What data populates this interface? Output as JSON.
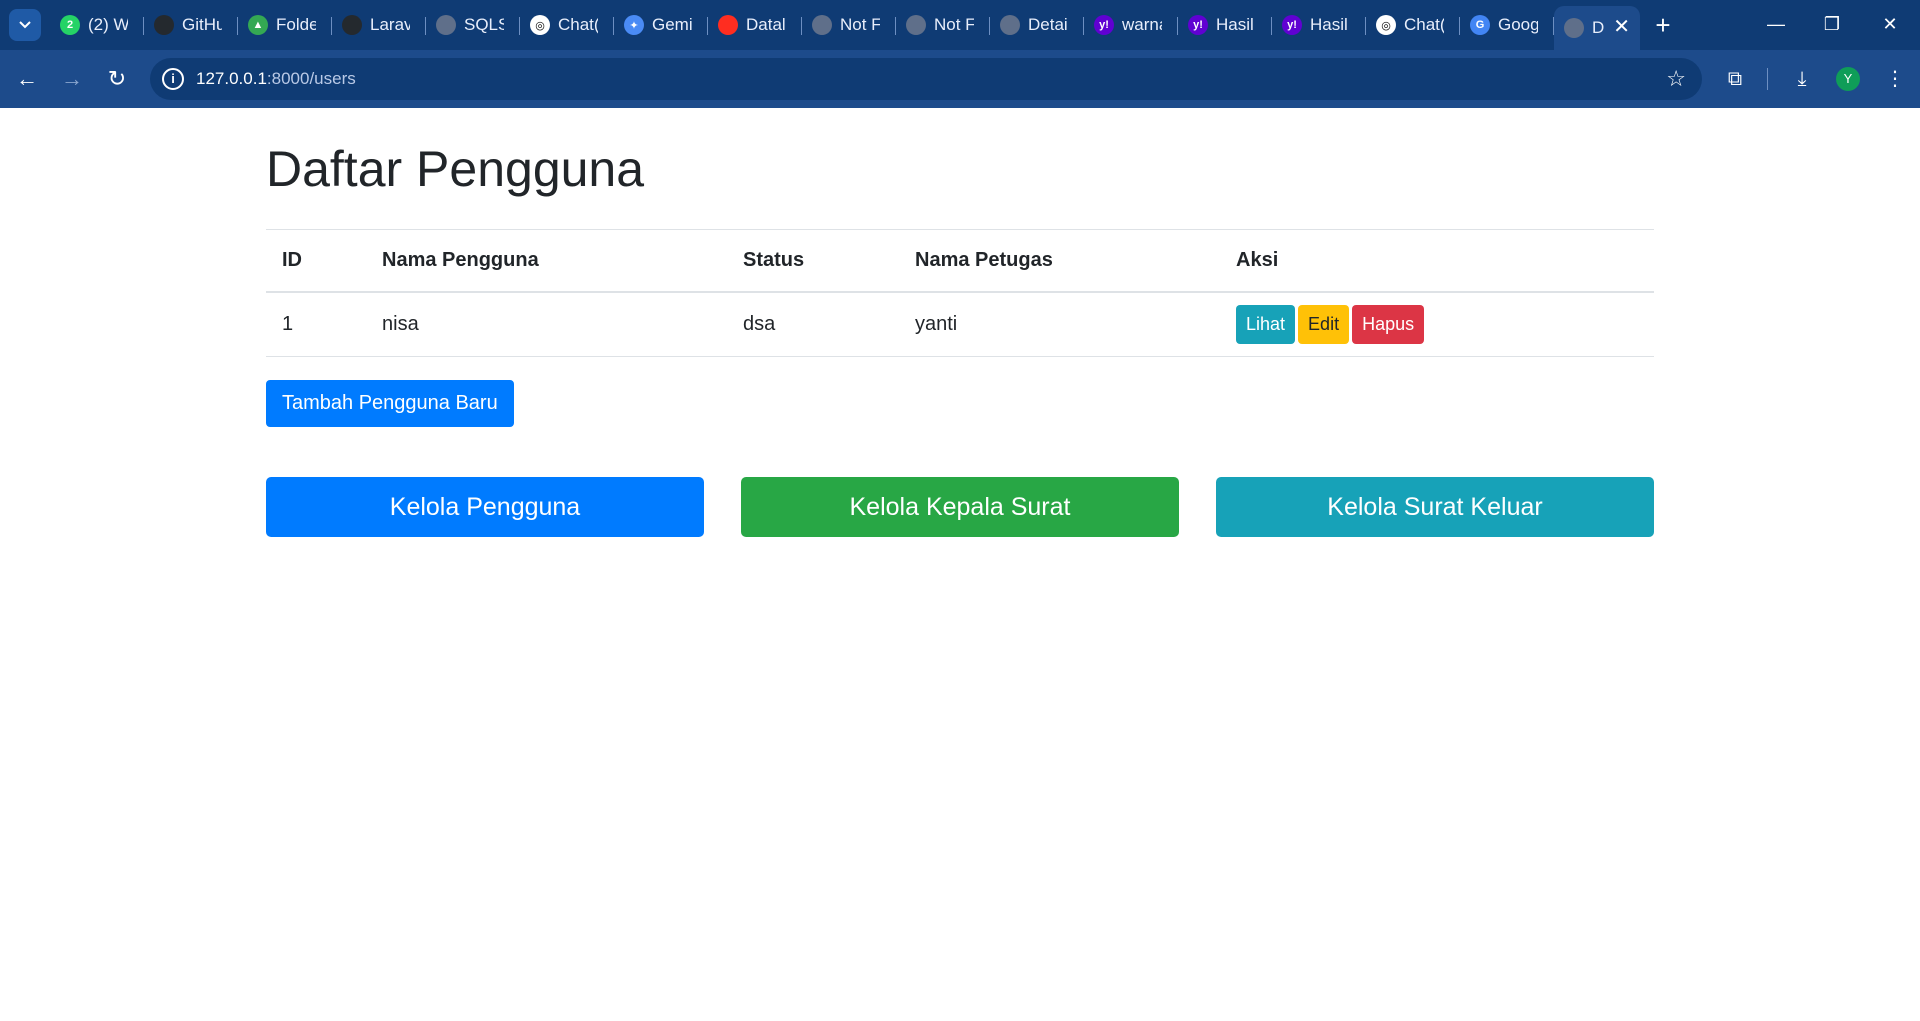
{
  "browser": {
    "tabs": [
      {
        "title": "(2) W",
        "icon": "whatsapp-icon",
        "color": "#25d366",
        "glyph": "2"
      },
      {
        "title": "GitHu",
        "icon": "github-icon",
        "color": "#24292e",
        "glyph": ""
      },
      {
        "title": "Folde",
        "icon": "google-drive-icon",
        "color": "#34a853",
        "glyph": "▲"
      },
      {
        "title": "Larav",
        "icon": "github-icon",
        "color": "#24292e",
        "glyph": ""
      },
      {
        "title": "SQLS",
        "icon": "globe-icon",
        "color": "#5f6f8a",
        "glyph": ""
      },
      {
        "title": "Chat(",
        "icon": "chatgpt-icon",
        "color": "#ffffff",
        "glyph": ""
      },
      {
        "title": "Gemi",
        "icon": "gemini-icon",
        "color": "#4a8bf5",
        "glyph": "✦"
      },
      {
        "title": "Datal",
        "icon": "laravel-icon",
        "color": "#ff2d20",
        "glyph": ""
      },
      {
        "title": "Not F",
        "icon": "globe-icon",
        "color": "#5f6f8a",
        "glyph": ""
      },
      {
        "title": "Not F",
        "icon": "globe-icon",
        "color": "#5f6f8a",
        "glyph": ""
      },
      {
        "title": "Detai",
        "icon": "globe-icon",
        "color": "#5f6f8a",
        "glyph": ""
      },
      {
        "title": "warna",
        "icon": "yahoo-icon",
        "color": "#6001d2",
        "glyph": "y!"
      },
      {
        "title": "Hasil",
        "icon": "yahoo-icon",
        "color": "#6001d2",
        "glyph": "y!"
      },
      {
        "title": "Hasil",
        "icon": "yahoo-icon",
        "color": "#6001d2",
        "glyph": "y!"
      },
      {
        "title": "Chat(",
        "icon": "chatgpt-icon",
        "color": "#ffffff",
        "glyph": ""
      },
      {
        "title": "Goog",
        "icon": "google-translate-icon",
        "color": "#4285f4",
        "glyph": "G"
      },
      {
        "title": "D",
        "icon": "globe-icon",
        "color": "#5f6f8a",
        "glyph": "",
        "active": true
      }
    ],
    "url_host": "127.0.0.1",
    "url_path": ":8000/users",
    "profile_initial": "Y"
  },
  "page": {
    "title": "Daftar Pengguna",
    "table": {
      "headers": [
        "ID",
        "Nama Pengguna",
        "Status",
        "Nama Petugas",
        "Aksi"
      ],
      "rows": [
        {
          "id": "1",
          "nama_pengguna": "nisa",
          "status": "dsa",
          "nama_petugas": "yanti"
        }
      ],
      "actions": {
        "view": "Lihat",
        "edit": "Edit",
        "delete": "Hapus"
      }
    },
    "add_button": "Tambah Pengguna Baru",
    "nav_buttons": {
      "users": "Kelola Pengguna",
      "kepala_surat": "Kelola Kepala Surat",
      "surat_keluar": "Kelola Surat Keluar"
    },
    "colors": {
      "primary": "#007bff",
      "success": "#28a745",
      "info": "#17a2b8",
      "warning": "#ffc107",
      "danger": "#dc3545"
    }
  }
}
